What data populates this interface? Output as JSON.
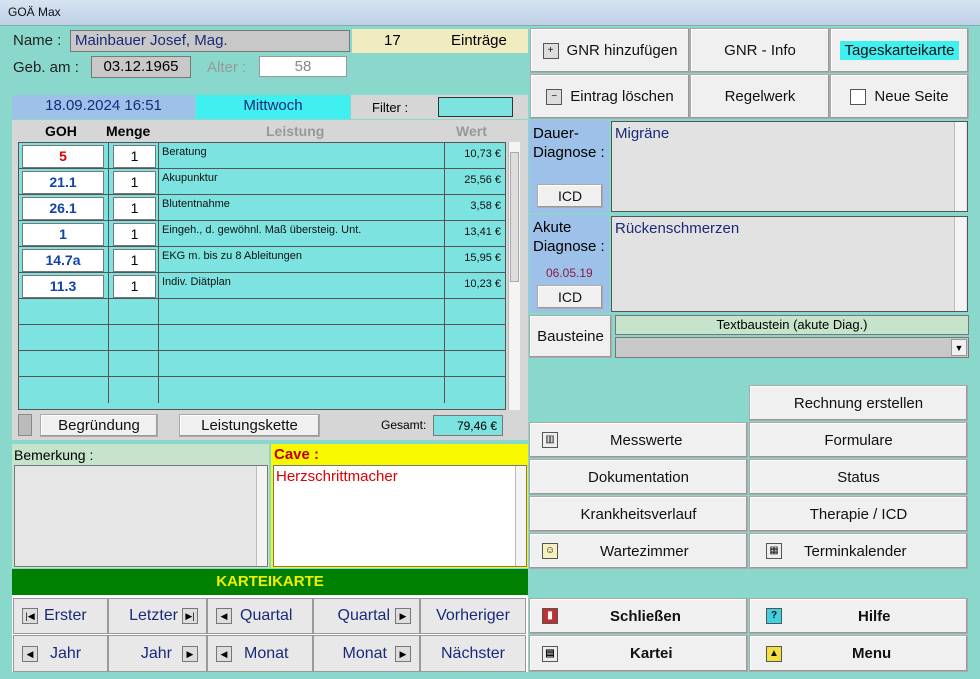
{
  "window": {
    "title": "GOÄ Max"
  },
  "patient": {
    "name_label": "Name :",
    "name": "Mainbauer Josef, Mag.",
    "count": "17",
    "count_label": "Einträge",
    "dob_label": "Geb. am :",
    "dob": "03.12.1965",
    "age_label": "Alter :",
    "age": "58"
  },
  "datebar": {
    "datetime": "18.09.2024 16:51",
    "weekday": "Mittwoch",
    "filter_label": "Filter :",
    "filter_value": ""
  },
  "table": {
    "headers": {
      "goh": "GOH",
      "menge": "Menge",
      "leistung": "Leistung",
      "wert": "Wert"
    },
    "rows": [
      {
        "goh": "5",
        "menge": "1",
        "leistung": "Beratung",
        "wert": "10,73 €"
      },
      {
        "goh": "21.1",
        "menge": "1",
        "leistung": "Akupunktur",
        "wert": "25,56 €"
      },
      {
        "goh": "26.1",
        "menge": "1",
        "leistung": "Blutentnahme",
        "wert": "3,58 €"
      },
      {
        "goh": "1",
        "menge": "1",
        "leistung": "Eingeh., d. gewöhnl. Maß übersteig. Unt.",
        "wert": "13,41 €"
      },
      {
        "goh": "14.7a",
        "menge": "1",
        "leistung": "EKG m. bis zu 8 Ableitungen",
        "wert": "15,95 €"
      },
      {
        "goh": "11.3",
        "menge": "1",
        "leistung": "Indiv. Diätplan",
        "wert": "10,23 €"
      }
    ],
    "total_label": "Gesamt:",
    "total": "79,46 €"
  },
  "actions": {
    "begruendung": "Begründung",
    "leistungskette": "Leistungskette"
  },
  "bemerkung": {
    "label": "Bemerkung :",
    "value": ""
  },
  "cave": {
    "label": "Cave :",
    "value": "Herzschrittmacher"
  },
  "karteikarte": {
    "title": "KARTEIKARTE",
    "nav": [
      "Erster",
      "Letzter",
      "Quartal",
      "Quartal",
      "Vorheriger",
      "Jahr",
      "Jahr",
      "Monat",
      "Monat",
      "Nächster"
    ]
  },
  "topbuttons": {
    "gnr_add": "GNR hinzufügen",
    "gnr_info": "GNR - Info",
    "tageskarte": "Tageskarteikarte",
    "entry_delete": "Eintrag löschen",
    "regelwerk": "Regelwerk",
    "neue_seite": "Neue Seite"
  },
  "diagnosis": {
    "dauer_label": "Dauer-Diagnose :",
    "dauer_value": "Migräne",
    "icd": "ICD",
    "akut_label": "Akute Diagnose :",
    "akut_date": "06.05.19",
    "akut_value": "Rückenschmerzen",
    "bausteine": "Bausteine",
    "textbaustein": "Textbaustein (akute Diag.)"
  },
  "menu": {
    "rechnung": "Rechnung erstellen",
    "messwerte": "Messwerte",
    "formulare": "Formulare",
    "dokumentation": "Dokumentation",
    "status": "Status",
    "krankheitsverlauf": "Krankheitsverlauf",
    "therapie": "Therapie / ICD",
    "wartezimmer": "Wartezimmer",
    "terminkalender": "Terminkalender",
    "schliessen": "Schließen",
    "hilfe": "Hilfe",
    "kartei": "Kartei",
    "menu": "Menu"
  },
  "colors": {
    "bg": "#8ad8cc",
    "cyan": "#7de3e0",
    "green": "#008000",
    "yellow": "#f0f000"
  }
}
